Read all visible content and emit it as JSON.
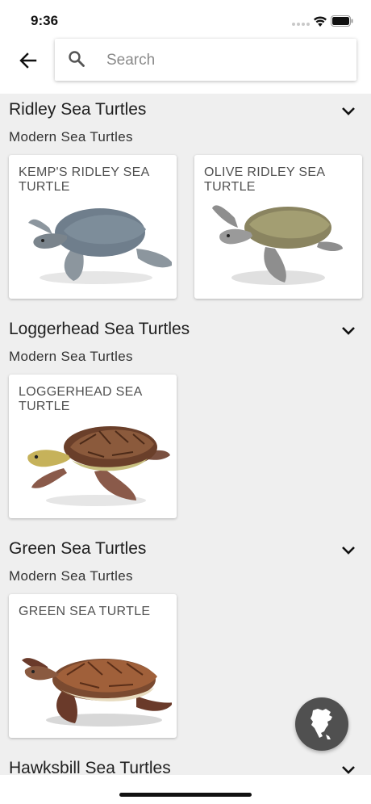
{
  "status_bar": {
    "time": "9:36"
  },
  "header": {
    "back_icon": "arrow-left-icon",
    "search": {
      "placeholder": "Search",
      "value": ""
    }
  },
  "sections": [
    {
      "title": "Ridley Sea Turtles",
      "subtitle": "Modern Sea Turtles",
      "cards": [
        {
          "title": "KEMP'S RIDLEY SEA TURTLE",
          "image": "kemps-ridley-turtle-image"
        },
        {
          "title": "OLIVE RIDLEY SEA TURTLE",
          "image": "olive-ridley-turtle-image"
        }
      ]
    },
    {
      "title": "Loggerhead Sea Turtles",
      "subtitle": "Modern Sea Turtles",
      "cards": [
        {
          "title": "LOGGERHEAD SEA TURTLE",
          "image": "loggerhead-turtle-image"
        }
      ]
    },
    {
      "title": "Green Sea Turtles",
      "subtitle": "Modern Sea Turtles",
      "cards": [
        {
          "title": "GREEN SEA TURTLE",
          "image": "green-sea-turtle-image"
        }
      ]
    },
    {
      "title": "Hawksbill Sea Turtles"
    }
  ],
  "map_button": {
    "icon": "north-america-map-icon"
  },
  "colors": {
    "background": "#efefef",
    "card": "#ffffff",
    "fab": "#505050",
    "text": "#202020"
  }
}
